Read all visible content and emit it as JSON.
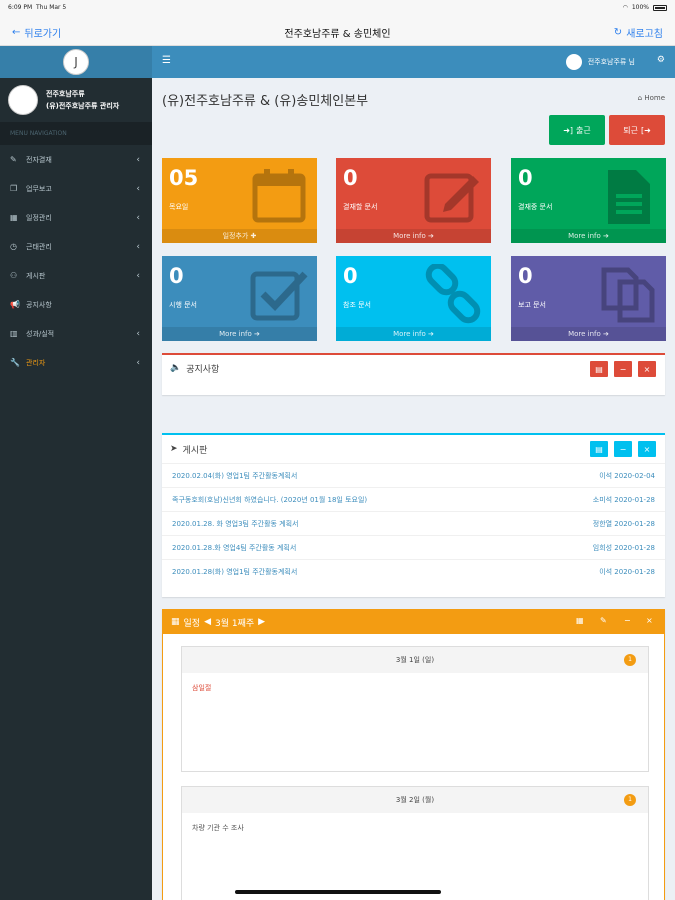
{
  "status": {
    "time": "6:09 PM",
    "date": "Thu Mar 5",
    "battery": "100%"
  },
  "nav": {
    "back_label": "뒤로가기",
    "title": "전주호남주류 & 송민체인",
    "refresh_label": "새로고침"
  },
  "sidebar": {
    "user_name": "전주호남주류",
    "user_role": "(유)전주호남주류 관리자",
    "menu_header": "MENU NAVIGATION",
    "items": [
      {
        "label": "전자결재",
        "icon": "edit-icon"
      },
      {
        "label": "업무보고",
        "icon": "copy-icon"
      },
      {
        "label": "일정관리",
        "icon": "calendar-icon"
      },
      {
        "label": "근태관리",
        "icon": "clock-icon"
      },
      {
        "label": "게시판",
        "icon": "users-icon"
      },
      {
        "label": "공지사항",
        "icon": "bullhorn-icon"
      },
      {
        "label": "성과/실적",
        "icon": "bar-chart-icon"
      },
      {
        "label": "관리자",
        "icon": "wrench-icon"
      }
    ]
  },
  "topbar": {
    "user_label": "전주호남주류 님"
  },
  "main": {
    "title": "(유)전주호남주류 & (유)송민체인본부",
    "breadcrumb": "Home",
    "btn_in": "출근",
    "btn_out": "퇴근"
  },
  "boxes": [
    {
      "value": "05",
      "label": "목요일",
      "footer": "일정추가 ✚",
      "color": "#f39c12"
    },
    {
      "value": "0",
      "label": "결재할 문서",
      "footer": "More info ➔",
      "color": "#dd4b39"
    },
    {
      "value": "0",
      "label": "결재중 문서",
      "footer": "More info ➔",
      "color": "#00a65a"
    },
    {
      "value": "0",
      "label": "시행 문서",
      "footer": "More info ➔",
      "color": "#3c8dbc"
    },
    {
      "value": "0",
      "label": "참조 문서",
      "footer": "More info ➔",
      "color": "#00c0ef"
    },
    {
      "value": "0",
      "label": "보고 문서",
      "footer": "More info ➔",
      "color": "#605ca8"
    }
  ],
  "notice": {
    "title": "공지사항"
  },
  "board": {
    "title": "게시판",
    "rows": [
      {
        "title": "2020.02.04(화) 영업1팀 주간활동계획서",
        "meta": "이석 2020-02-04"
      },
      {
        "title": "족구동호회(호남)신년회 하였습니다. (2020년 01월 18일 토요일)",
        "meta": "소미석 2020-01-28"
      },
      {
        "title": "2020.01.28. 화 영업3팀 주간활동 계획서",
        "meta": "정한열 2020-01-28"
      },
      {
        "title": "2020.01.28.화 영업4팀 주간활동 계획서",
        "meta": "임희성 2020-01-28"
      },
      {
        "title": "2020.01.28(화) 영업1팀 주간활동계획서",
        "meta": "이석 2020-01-28"
      }
    ]
  },
  "calendar": {
    "title": "일정",
    "week": "3월 1째주",
    "days": [
      {
        "date": "3월 1일 (일)",
        "count": "1",
        "entry": "삼일절",
        "entry_color": "#dd4b39"
      },
      {
        "date": "3월 2일 (월)",
        "count": "1",
        "entry": "차량 기관 수 조사",
        "entry_color": "#555555"
      }
    ]
  }
}
